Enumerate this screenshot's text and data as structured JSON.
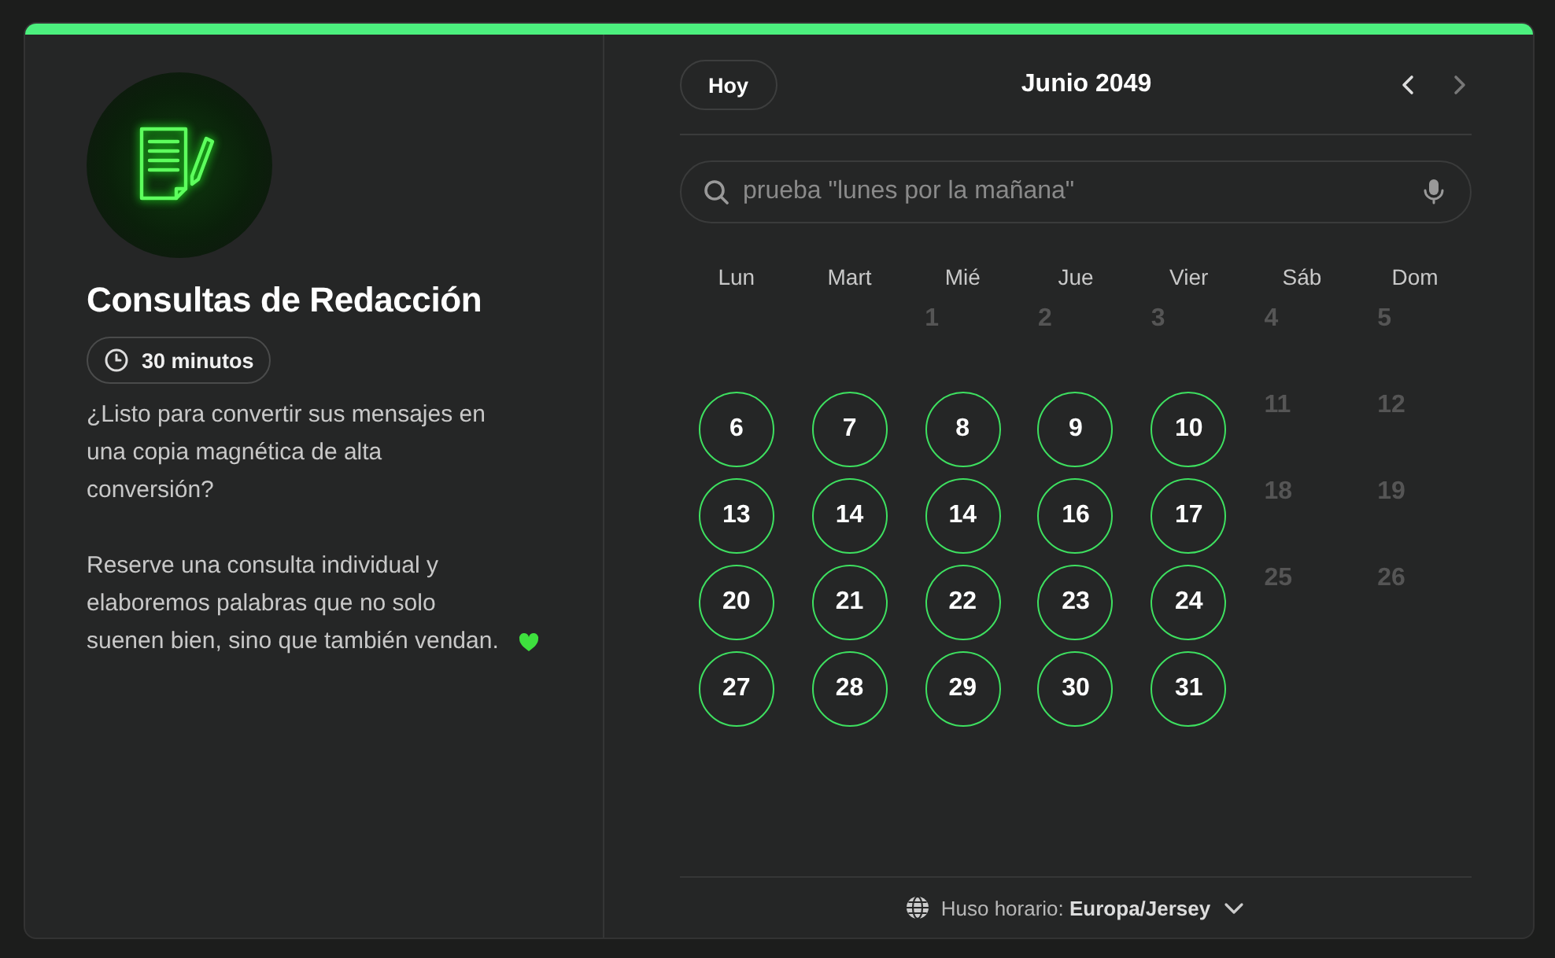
{
  "event": {
    "title": "Consultas de Redacción",
    "duration": "30 minutos",
    "description": [
      "¿Listo para convertir sus mensajes en una copia magnética de alta conversión?",
      "Reserve una consulta individual y elaboremos palabras que no solo suenen bien, sino que también vendan."
    ]
  },
  "calendar": {
    "today_button": "Hoy",
    "month": "Junio 2049",
    "prev_disabled": false,
    "next_disabled": true,
    "search": {
      "placeholder": "prueba \"lunes por la mañana\""
    },
    "weekdays": [
      "Lun",
      "Mart",
      "Mié",
      "Jue",
      "Vier",
      "Sáb",
      "Dom"
    ],
    "weeks": [
      {
        "days": [
          {
            "label": "1",
            "available": false
          },
          {
            "label": "2",
            "available": false
          },
          {
            "label": "3",
            "available": false
          },
          {
            "label": "4",
            "available": false
          },
          {
            "label": "5",
            "available": false
          }
        ]
      },
      {
        "days": [
          {
            "label": "6",
            "available": true
          },
          {
            "label": "7",
            "available": true
          },
          {
            "label": "8",
            "available": true
          },
          {
            "label": "9",
            "available": true
          },
          {
            "label": "10",
            "available": true
          },
          {
            "label": "11",
            "available": false
          },
          {
            "label": "12",
            "available": false
          }
        ]
      },
      {
        "days": [
          {
            "label": "13",
            "available": true
          },
          {
            "label": "14",
            "available": true
          },
          {
            "label": "14",
            "available": true
          },
          {
            "label": "16",
            "available": true
          },
          {
            "label": "17",
            "available": true
          },
          {
            "label": "18",
            "available": false
          },
          {
            "label": "19",
            "available": false
          }
        ]
      },
      {
        "days": [
          {
            "label": "20",
            "available": true
          },
          {
            "label": "21",
            "available": true
          },
          {
            "label": "22",
            "available": true
          },
          {
            "label": "23",
            "available": true
          },
          {
            "label": "24",
            "available": true
          },
          {
            "label": "25",
            "available": false
          },
          {
            "label": "26",
            "available": false
          }
        ]
      },
      {
        "days": [
          {
            "label": "27",
            "available": true
          },
          {
            "label": "28",
            "available": true
          },
          {
            "label": "29",
            "available": true
          },
          {
            "label": "30",
            "available": true
          },
          {
            "label": "31",
            "available": true
          }
        ]
      }
    ],
    "timezone": "Huso horario: **Europa/Jersey**"
  }
}
